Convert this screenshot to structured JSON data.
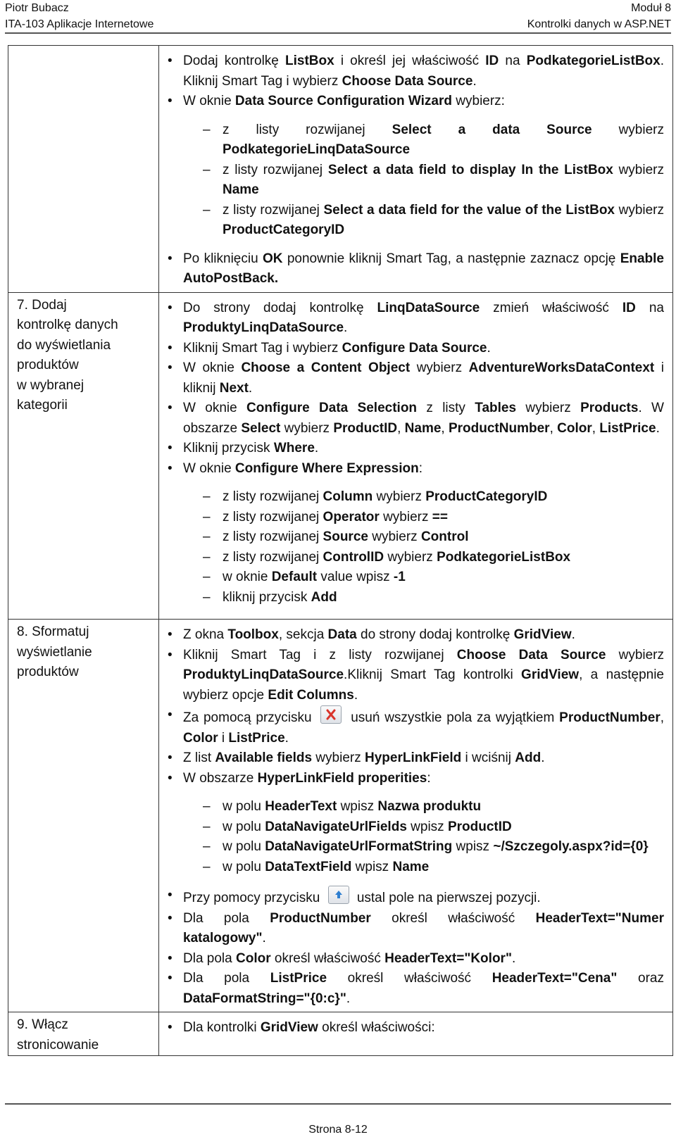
{
  "header": {
    "author": "Piotr Bubacz",
    "course": "ITA-103 Aplikacje Internetowe",
    "module": "Moduł 8",
    "topic": "Kontrolki danych w ASP.NET"
  },
  "footer": {
    "page": "Strona 8-12"
  },
  "rows": [
    {
      "label": "",
      "items": [
        {
          "html": "Dodaj kontrolkę <b>ListBox</b> i określ jej właściwość <b>ID</b> na <b>PodkategorieListBox</b>. Kliknij Smart Tag i wybierz <b>Choose Data Source</b>."
        },
        {
          "html": "W oknie <b>Data Source Configuration Wizard</b> wybierz:",
          "sub": [
            "z listy rozwijanej <b>Select a data Source</b> wybierz <b>PodkategorieLinqDataSource</b>",
            "z listy rozwijanej <b>Select a data field to display In the ListBox</b> wybierz <b>Name</b>",
            "z listy rozwijanej <b>Select a data field for the value of the ListBox</b> wybierz <b>ProductCategoryID</b>"
          ]
        },
        {
          "html": "Po kliknięciu <b>OK</b> ponownie kliknij Smart Tag, a następnie zaznacz opcję <b>Enable AutoPostBack.</b>"
        }
      ]
    },
    {
      "label": "7. Dodaj kontrolkę danych do wyświetlania produktów w wybranej kategorii",
      "label_lines": [
        "7.  Dodaj",
        "kontrolkę danych",
        "do wyświetlania",
        "produktów",
        "w wybranej",
        "kategorii"
      ],
      "items": [
        {
          "html": "Do strony dodaj kontrolkę <b>LinqDataSource</b> zmień właściwość <b>ID</b> na <b>ProduktyLinqDataSource</b>."
        },
        {
          "html": "Kliknij Smart Tag i wybierz <b>Configure Data Source</b>."
        },
        {
          "html": "W oknie <b>Choose a Content Object</b> wybierz <b>AdventureWorksDataContext</b> i kliknij <b>Next</b>."
        },
        {
          "html": "W oknie <b>Configure Data Selection</b> z listy <b>Tables</b> wybierz <b>Products</b>. W obszarze <b>Select</b> wybierz <b>ProductID</b>, <b>Name</b>, <b>ProductNumber</b>, <b>Color</b>, <b>ListPrice</b>."
        },
        {
          "html": "Kliknij przycisk <b>Where</b>."
        },
        {
          "html": "W oknie <b>Configure Where Expression</b>:",
          "sub": [
            "z listy rozwijanej <b>Column</b> wybierz <b>ProductCategoryID</b>",
            "z listy rozwijanej <b>Operator</b> wybierz <b>==</b>",
            "z listy rozwijanej <b>Source</b> wybierz <b>Control</b>",
            "z listy rozwijanej <b>ControlID</b> wybierz <b>PodkategorieListBox</b>",
            "w oknie <b>Default</b> value wpisz <b>-1</b>",
            "kliknij przycisk <b>Add</b>"
          ]
        }
      ]
    },
    {
      "label": "8. Sformatuj wyświetlanie produktów",
      "label_lines": [
        "8.  Sformatuj",
        "wyświetlanie",
        "produktów"
      ],
      "items": [
        {
          "html": "Z okna <b>Toolbox</b>, sekcja <b>Data</b> do strony dodaj kontrolkę <b>GridView</b>."
        },
        {
          "html": "Kliknij Smart Tag i z listy rozwijanej <b>Choose Data Source</b> wybierz <b>ProduktyLinqDataSource</b>.Kliknij Smart Tag kontrolki <b>GridView</b>, a następnie wybierz opcje <b>Edit Columns</b>."
        },
        {
          "html": "Za pomocą przycisku {icon:delete-icon} usuń wszystkie pola za wyjątkiem <b>ProductNumber</b>, <b>Color</b> i <b>ListPrice</b>."
        },
        {
          "html": "Z list <b>Available fields</b> wybierz <b>HyperLinkField</b> i wciśnij <b>Add</b>."
        },
        {
          "html": "W obszarze <b>HyperLinkField properities</b>:",
          "sub": [
            "w polu <b>HeaderText</b> wpisz <b>Nazwa produktu</b>",
            "w polu <b>DataNavigateUrlFields</b> wpisz <b>ProductID</b>",
            "w polu <b>DataNavigateUrlFormatString</b> wpisz <b>~/Szczegoly.aspx?id={0}</b>",
            "w polu <b>DataTextField</b> wpisz <b>Name</b>"
          ]
        },
        {
          "html": "Przy pomocy przycisku {icon:move-up-icon} ustal pole na pierwszej pozycji."
        },
        {
          "html": "Dla pola <b>ProductNumber</b> określ właściwość <b>HeaderText=\"Numer katalogowy\"</b>."
        },
        {
          "html": "Dla pola <b>Color</b> określ właściwość <b>HeaderText=\"Kolor\"</b>."
        },
        {
          "html": "Dla pola <b>ListPrice</b> określ właściwość <b>HeaderText=\"Cena\"</b> oraz <b>DataFormatString=\"{0:c}\"</b>."
        }
      ]
    },
    {
      "label": "9. Włącz stronicowanie",
      "label_lines": [
        "9.  Włącz",
        "stronicowanie"
      ],
      "items": [
        {
          "html": "Dla kontrolki <b>GridView</b> określ właściwości:"
        }
      ]
    }
  ],
  "icons": {
    "delete-icon": {
      "glyph": "x",
      "color": "#d9342b"
    },
    "move-up-icon": {
      "glyph": "arrow-up",
      "color": "#2f7fd0"
    }
  }
}
